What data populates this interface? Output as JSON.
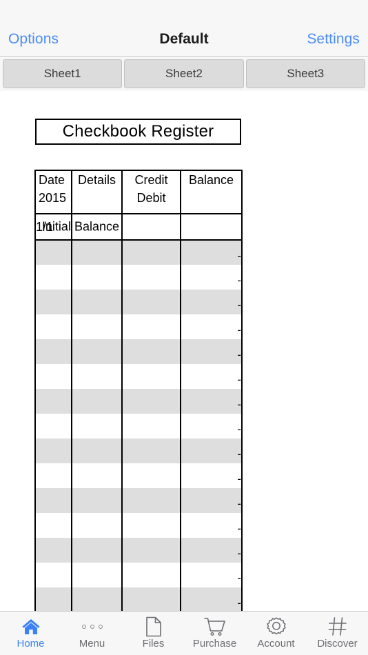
{
  "nav": {
    "left_label": "Options",
    "title": "Default",
    "right_label": "Settings",
    "accent_color": "#4a8cf7"
  },
  "sheet_tabs": [
    {
      "label": "Sheet1"
    },
    {
      "label": "Sheet2"
    },
    {
      "label": "Sheet3"
    }
  ],
  "sheet": {
    "title": "Checkbook Register",
    "table": {
      "headers": [
        {
          "line1": "Date",
          "line2": "2015"
        },
        {
          "line1": "Details",
          "line2": ""
        },
        {
          "line1": "Credit",
          "line2": "Debit"
        },
        {
          "line1": "Balance",
          "line2": ""
        }
      ],
      "initial_row": {
        "date": "1/1",
        "details": "Initial Balance",
        "credit_debit": "",
        "balance": ""
      },
      "empty_balance_value": "-",
      "rows": [
        {
          "date": "",
          "details": "",
          "credit_debit": "",
          "balance": "-"
        },
        {
          "date": "",
          "details": "",
          "credit_debit": "",
          "balance": "-"
        },
        {
          "date": "",
          "details": "",
          "credit_debit": "",
          "balance": "-"
        },
        {
          "date": "",
          "details": "",
          "credit_debit": "",
          "balance": "-"
        },
        {
          "date": "",
          "details": "",
          "credit_debit": "",
          "balance": "-"
        },
        {
          "date": "",
          "details": "",
          "credit_debit": "",
          "balance": "-"
        },
        {
          "date": "",
          "details": "",
          "credit_debit": "",
          "balance": "-"
        },
        {
          "date": "",
          "details": "",
          "credit_debit": "",
          "balance": "-"
        },
        {
          "date": "",
          "details": "",
          "credit_debit": "",
          "balance": "-"
        },
        {
          "date": "",
          "details": "",
          "credit_debit": "",
          "balance": "-"
        },
        {
          "date": "",
          "details": "",
          "credit_debit": "",
          "balance": "-"
        },
        {
          "date": "",
          "details": "",
          "credit_debit": "",
          "balance": "-"
        },
        {
          "date": "",
          "details": "",
          "credit_debit": "",
          "balance": "-"
        },
        {
          "date": "",
          "details": "",
          "credit_debit": "",
          "balance": "-"
        },
        {
          "date": "",
          "details": "",
          "credit_debit": "",
          "balance": "-"
        }
      ]
    }
  },
  "tab_bar": {
    "active_index": 0,
    "active_color": "#3b82f6",
    "inactive_color": "#6d6d72",
    "items": [
      {
        "label": "Home",
        "icon": "home-icon"
      },
      {
        "label": "Menu",
        "icon": "dots-menu-icon"
      },
      {
        "label": "Files",
        "icon": "document-icon"
      },
      {
        "label": "Purchase",
        "icon": "shopping-cart-icon"
      },
      {
        "label": "Account",
        "icon": "gear-icon"
      },
      {
        "label": "Discover",
        "icon": "hash-grid-icon"
      }
    ]
  }
}
